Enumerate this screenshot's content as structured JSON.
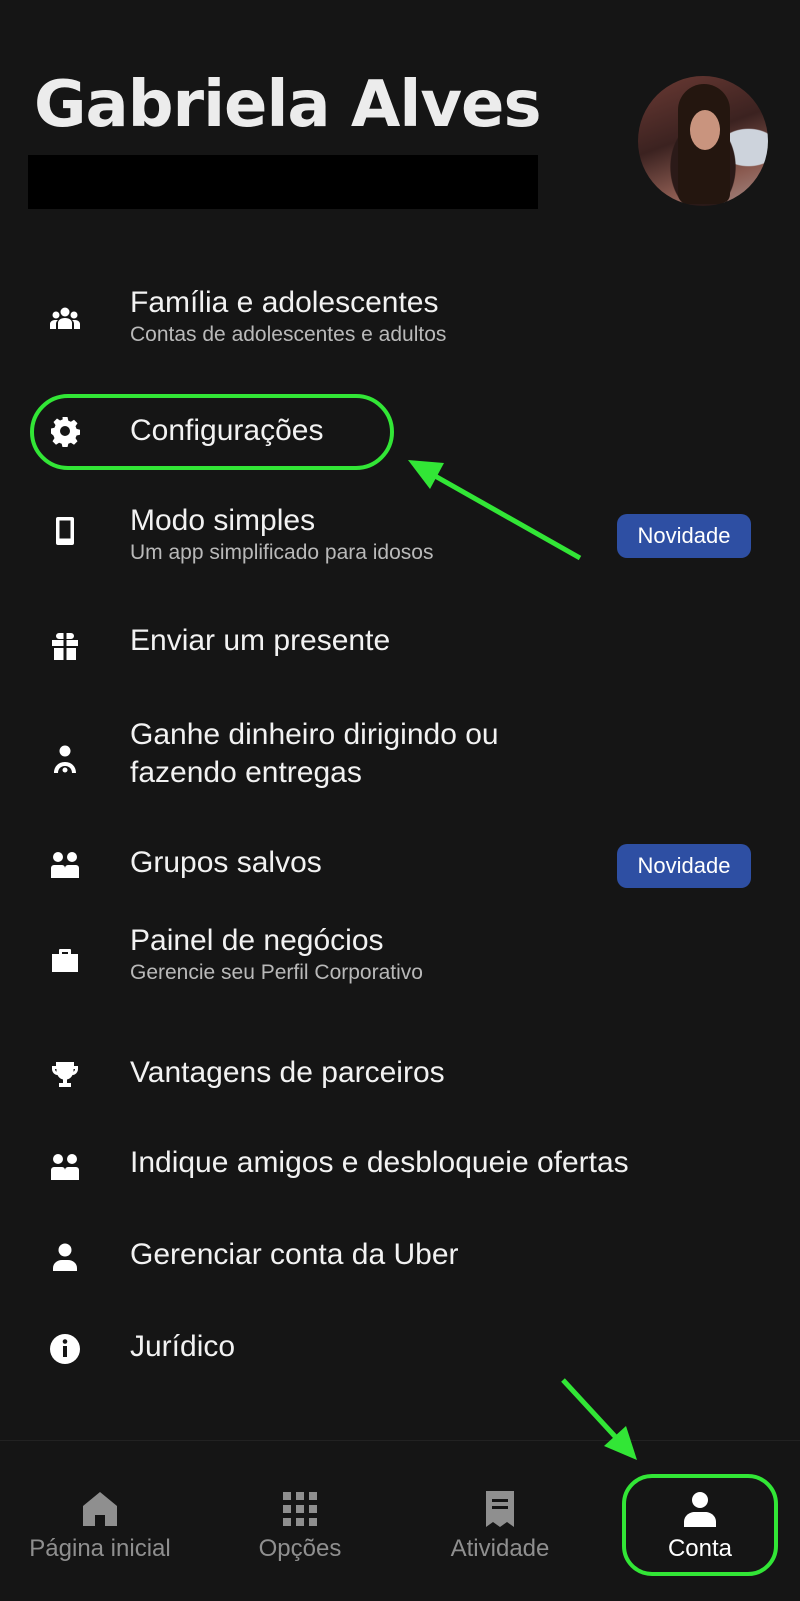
{
  "profile": {
    "name": "Gabriela Alves"
  },
  "menu": [
    {
      "title": "Família e adolescentes",
      "subtitle": "Contas de adolescentes e adultos",
      "icon": "family-icon"
    },
    {
      "title": "Configurações",
      "subtitle": "",
      "icon": "gear-icon"
    },
    {
      "title": "Modo simples",
      "subtitle": "Um app simplificado para idosos",
      "icon": "phone-icon",
      "badge": "Novidade"
    },
    {
      "title": "Enviar um presente",
      "subtitle": "",
      "icon": "gift-icon"
    },
    {
      "title_line1": "Ganhe dinheiro dirigindo ou",
      "title_line2": "fazendo entregas",
      "icon": "driver-icon"
    },
    {
      "title": "Grupos salvos",
      "subtitle": "",
      "icon": "group-icon",
      "badge": "Novidade"
    },
    {
      "title": "Painel de negócios",
      "subtitle": "Gerencie seu Perfil Corporativo",
      "icon": "briefcase-icon"
    },
    {
      "title": "Vantagens de parceiros",
      "subtitle": "",
      "icon": "trophy-icon"
    },
    {
      "title": "Indique amigos e desbloqueie ofertas",
      "subtitle": "",
      "icon": "group-icon"
    },
    {
      "title": "Gerenciar conta da Uber",
      "subtitle": "",
      "icon": "person-icon"
    },
    {
      "title": "Jurídico",
      "subtitle": "",
      "icon": "info-icon"
    }
  ],
  "bottom_nav": [
    {
      "label": "Página inicial",
      "icon": "home-icon"
    },
    {
      "label": "Opções",
      "icon": "grid-icon"
    },
    {
      "label": "Atividade",
      "icon": "receipt-icon"
    },
    {
      "label": "Conta",
      "icon": "person-icon",
      "active": true
    }
  ],
  "colors": {
    "background": "#151515",
    "badge": "#2e4fa3",
    "annotation": "#32e636"
  }
}
